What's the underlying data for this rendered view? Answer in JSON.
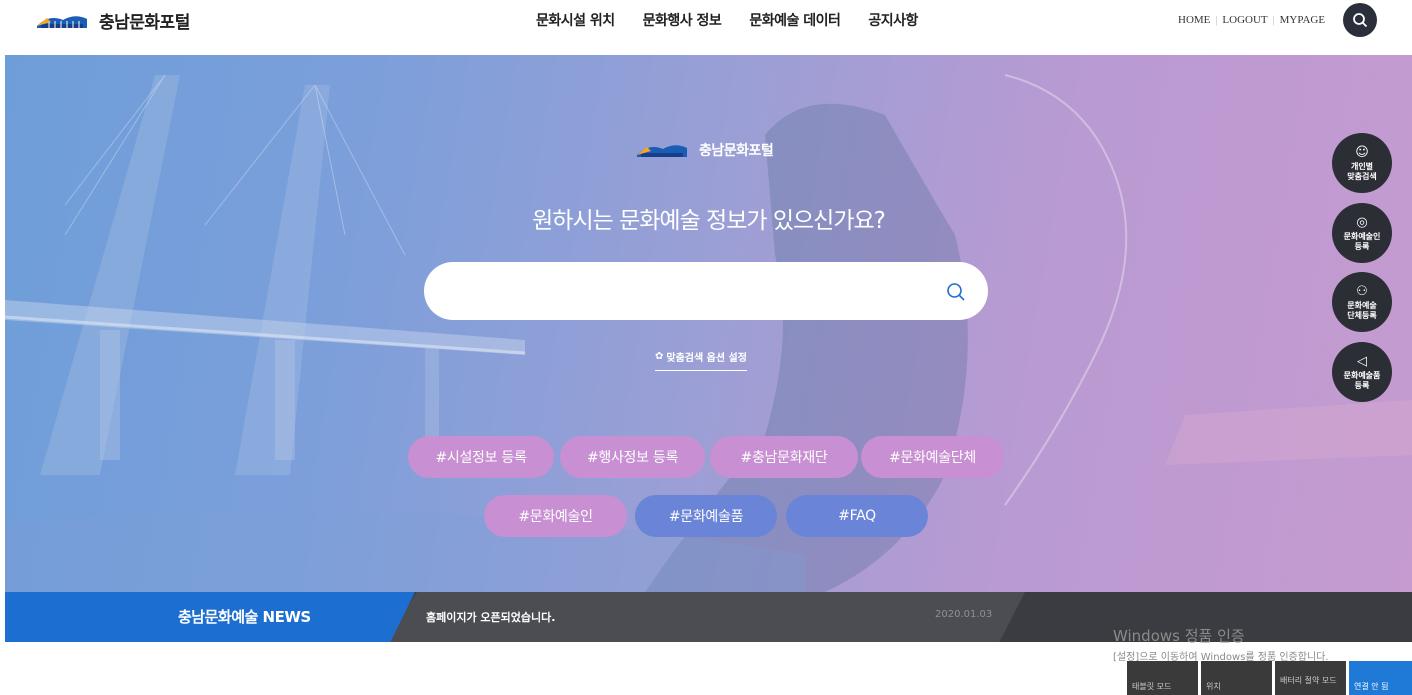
{
  "header": {
    "logo_text": "충남문화포털",
    "nav": [
      "문화시설 위치",
      "문화행사 정보",
      "문화예술 데이터",
      "공지사항"
    ],
    "util": [
      "HOME",
      "LOGOUT",
      "MYPAGE"
    ]
  },
  "hero": {
    "logo_text": "충남문화포털",
    "headline": "원하시는 문화예술 정보가 있으신가요?",
    "search_placeholder": "",
    "option_link": "맞춤검색 옵션 설정",
    "tags_row1": [
      "#시설정보 등록",
      "#행사정보 등록",
      "#충남문화재단",
      "#문화예술단체"
    ],
    "tags_row2": [
      "#문화예술인",
      "#문화예술품",
      "#FAQ"
    ]
  },
  "quick_menu": [
    {
      "line1": "개인별",
      "line2": "맞춤검색"
    },
    {
      "line1": "문화예술인",
      "line2": "등록"
    },
    {
      "line1": "문화예술",
      "line2": "단체등록"
    },
    {
      "line1": "문화예술품",
      "line2": "등록"
    }
  ],
  "news": {
    "label": "충남문화예술 NEWS",
    "text": "홈페이지가 오픈되었습니다.",
    "date": "2020.01.03"
  },
  "windows": {
    "title": "Windows 정품 인증",
    "subtitle": "[설정]으로 이동하여 Windows를 정품 인증합니다.",
    "tiles": [
      "태블릿 모드",
      "위치",
      "배터리 절약 모드",
      "연결 안 됨"
    ]
  },
  "colors": {
    "accent_blue": "#1c6fd1",
    "tag_pink": "#c88fd2",
    "tag_blue": "#6a84d8",
    "dark": "#2b2e35"
  }
}
